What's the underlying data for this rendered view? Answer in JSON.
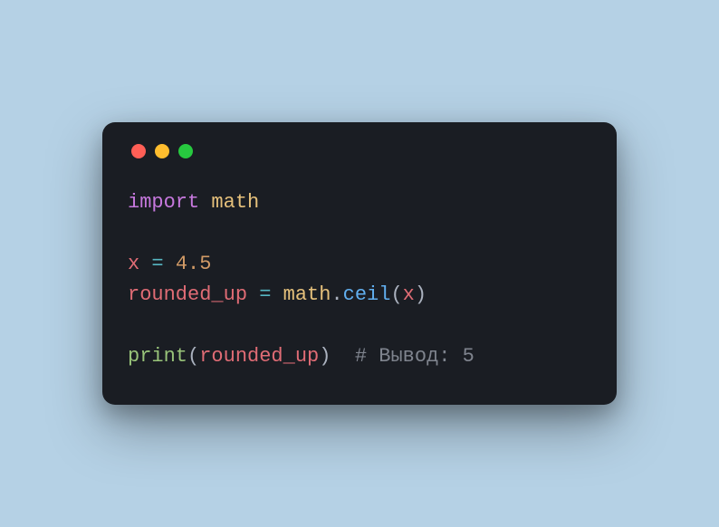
{
  "traffic_lights": {
    "red": "#ff5f56",
    "yellow": "#ffbd2e",
    "green": "#27c93f"
  },
  "code": {
    "line1": {
      "keyword": "import",
      "module": "math"
    },
    "line2_blank": "",
    "line3": {
      "var": "x",
      "op": "=",
      "number": "4.5"
    },
    "line4": {
      "var": "rounded_up",
      "op": "=",
      "module": "math",
      "dot": ".",
      "func": "ceil",
      "paren_open": "(",
      "arg": "x",
      "paren_close": ")"
    },
    "line5_blank": "",
    "line6": {
      "call": "print",
      "paren_open": "(",
      "arg": "rounded_up",
      "paren_close": ")",
      "spacer": "  ",
      "comment": "# Вывод: 5"
    }
  }
}
